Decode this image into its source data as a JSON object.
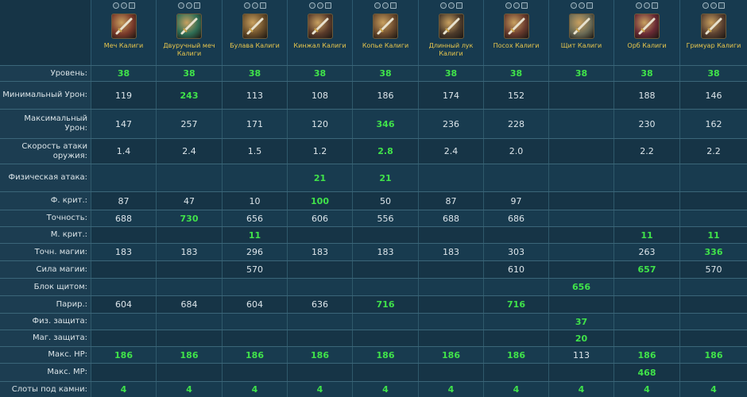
{
  "items": [
    {
      "name": "Меч Калиги",
      "icon": "sword-icon",
      "color": "#7a3a2a"
    },
    {
      "name": "Двуручный меч Калиги",
      "icon": "greatsword-icon",
      "color": "#2f6e55"
    },
    {
      "name": "Булава Калиги",
      "icon": "mace-icon",
      "color": "#6a4e2a"
    },
    {
      "name": "Кинжал Калиги",
      "icon": "dagger-icon",
      "color": "#5a3b2a"
    },
    {
      "name": "Копье Калиги",
      "icon": "spear-icon",
      "color": "#6b4a2d"
    },
    {
      "name": "Длинный лук Калиги",
      "icon": "longbow-icon",
      "color": "#4c3a2a"
    },
    {
      "name": "Посох Калиги",
      "icon": "staff-icon",
      "color": "#6a3b2d"
    },
    {
      "name": "Щит Калиги",
      "icon": "shield-icon",
      "color": "#6a6a55"
    },
    {
      "name": "Орб Калиги",
      "icon": "orb-icon",
      "color": "#6a2a35"
    },
    {
      "name": "Гримуар Калиги",
      "icon": "grimoire-icon",
      "color": "#5a4030"
    }
  ],
  "rows": [
    {
      "label": "Уровень:",
      "cells": [
        {
          "v": "38",
          "hi": true
        },
        {
          "v": "38",
          "hi": true
        },
        {
          "v": "38",
          "hi": true
        },
        {
          "v": "38",
          "hi": true
        },
        {
          "v": "38",
          "hi": true
        },
        {
          "v": "38",
          "hi": true
        },
        {
          "v": "38",
          "hi": true
        },
        {
          "v": "38",
          "hi": true
        },
        {
          "v": "38",
          "hi": true
        },
        {
          "v": "38",
          "hi": true
        }
      ]
    },
    {
      "label": "Минимальный Урон:",
      "cells": [
        {
          "v": "119"
        },
        {
          "v": "243",
          "hi": true
        },
        {
          "v": "113"
        },
        {
          "v": "108"
        },
        {
          "v": "186"
        },
        {
          "v": "174"
        },
        {
          "v": "152"
        },
        {
          "v": ""
        },
        {
          "v": "188"
        },
        {
          "v": "146"
        }
      ]
    },
    {
      "label": "Максимальный Урон:",
      "cells": [
        {
          "v": "147"
        },
        {
          "v": "257"
        },
        {
          "v": "171"
        },
        {
          "v": "120"
        },
        {
          "v": "346",
          "hi": true
        },
        {
          "v": "236"
        },
        {
          "v": "228"
        },
        {
          "v": ""
        },
        {
          "v": "230"
        },
        {
          "v": "162"
        }
      ]
    },
    {
      "label": "Скорость атаки оружия:",
      "cells": [
        {
          "v": "1.4"
        },
        {
          "v": "2.4"
        },
        {
          "v": "1.5"
        },
        {
          "v": "1.2"
        },
        {
          "v": "2.8",
          "hi": true
        },
        {
          "v": "2.4"
        },
        {
          "v": "2.0"
        },
        {
          "v": ""
        },
        {
          "v": "2.2"
        },
        {
          "v": "2.2"
        }
      ]
    },
    {
      "label": "Физическая атака:",
      "cells": [
        {
          "v": ""
        },
        {
          "v": ""
        },
        {
          "v": ""
        },
        {
          "v": "21",
          "hi": true
        },
        {
          "v": "21",
          "hi": true
        },
        {
          "v": ""
        },
        {
          "v": ""
        },
        {
          "v": ""
        },
        {
          "v": ""
        },
        {
          "v": ""
        }
      ]
    },
    {
      "label": "Ф. крит.:",
      "cells": [
        {
          "v": "87"
        },
        {
          "v": "47"
        },
        {
          "v": "10"
        },
        {
          "v": "100",
          "hi": true
        },
        {
          "v": "50"
        },
        {
          "v": "87"
        },
        {
          "v": "97"
        },
        {
          "v": ""
        },
        {
          "v": ""
        },
        {
          "v": ""
        }
      ]
    },
    {
      "label": "Точность:",
      "cells": [
        {
          "v": "688"
        },
        {
          "v": "730",
          "hi": true
        },
        {
          "v": "656"
        },
        {
          "v": "606"
        },
        {
          "v": "556"
        },
        {
          "v": "688"
        },
        {
          "v": "686"
        },
        {
          "v": ""
        },
        {
          "v": ""
        },
        {
          "v": ""
        }
      ]
    },
    {
      "label": "М. крит.:",
      "cells": [
        {
          "v": ""
        },
        {
          "v": ""
        },
        {
          "v": "11",
          "hi": true
        },
        {
          "v": ""
        },
        {
          "v": ""
        },
        {
          "v": ""
        },
        {
          "v": ""
        },
        {
          "v": ""
        },
        {
          "v": "11",
          "hi": true
        },
        {
          "v": "11",
          "hi": true
        }
      ]
    },
    {
      "label": "Точн. магии:",
      "cells": [
        {
          "v": "183"
        },
        {
          "v": "183"
        },
        {
          "v": "296"
        },
        {
          "v": "183"
        },
        {
          "v": "183"
        },
        {
          "v": "183"
        },
        {
          "v": "303"
        },
        {
          "v": ""
        },
        {
          "v": "263"
        },
        {
          "v": "336",
          "hi": true
        }
      ]
    },
    {
      "label": "Сила магии:",
      "cells": [
        {
          "v": ""
        },
        {
          "v": ""
        },
        {
          "v": "570"
        },
        {
          "v": ""
        },
        {
          "v": ""
        },
        {
          "v": ""
        },
        {
          "v": "610"
        },
        {
          "v": ""
        },
        {
          "v": "657",
          "hi": true
        },
        {
          "v": "570"
        }
      ]
    },
    {
      "label": "Блок щитом:",
      "cells": [
        {
          "v": ""
        },
        {
          "v": ""
        },
        {
          "v": ""
        },
        {
          "v": ""
        },
        {
          "v": ""
        },
        {
          "v": ""
        },
        {
          "v": ""
        },
        {
          "v": "656",
          "hi": true
        },
        {
          "v": ""
        },
        {
          "v": ""
        }
      ]
    },
    {
      "label": "Парир.:",
      "cells": [
        {
          "v": "604"
        },
        {
          "v": "684"
        },
        {
          "v": "604"
        },
        {
          "v": "636"
        },
        {
          "v": "716",
          "hi": true
        },
        {
          "v": ""
        },
        {
          "v": "716",
          "hi": true
        },
        {
          "v": ""
        },
        {
          "v": ""
        },
        {
          "v": ""
        }
      ]
    },
    {
      "label": "Физ. защита:",
      "cells": [
        {
          "v": ""
        },
        {
          "v": ""
        },
        {
          "v": ""
        },
        {
          "v": ""
        },
        {
          "v": ""
        },
        {
          "v": ""
        },
        {
          "v": ""
        },
        {
          "v": "37",
          "hi": true
        },
        {
          "v": ""
        },
        {
          "v": ""
        }
      ]
    },
    {
      "label": "Маг. защита:",
      "cells": [
        {
          "v": ""
        },
        {
          "v": ""
        },
        {
          "v": ""
        },
        {
          "v": ""
        },
        {
          "v": ""
        },
        {
          "v": ""
        },
        {
          "v": ""
        },
        {
          "v": "20",
          "hi": true
        },
        {
          "v": ""
        },
        {
          "v": ""
        }
      ]
    },
    {
      "label": "Макс. HP:",
      "cells": [
        {
          "v": "186",
          "hi": true
        },
        {
          "v": "186",
          "hi": true
        },
        {
          "v": "186",
          "hi": true
        },
        {
          "v": "186",
          "hi": true
        },
        {
          "v": "186",
          "hi": true
        },
        {
          "v": "186",
          "hi": true
        },
        {
          "v": "186",
          "hi": true
        },
        {
          "v": "113"
        },
        {
          "v": "186",
          "hi": true
        },
        {
          "v": "186",
          "hi": true
        }
      ]
    },
    {
      "label": "Макс. MP:",
      "cells": [
        {
          "v": ""
        },
        {
          "v": ""
        },
        {
          "v": ""
        },
        {
          "v": ""
        },
        {
          "v": ""
        },
        {
          "v": ""
        },
        {
          "v": ""
        },
        {
          "v": ""
        },
        {
          "v": "468",
          "hi": true
        },
        {
          "v": ""
        }
      ]
    },
    {
      "label": "Слоты под камни:",
      "cells": [
        {
          "v": "4",
          "hi": true
        },
        {
          "v": "4",
          "hi": true
        },
        {
          "v": "4",
          "hi": true
        },
        {
          "v": "4",
          "hi": true
        },
        {
          "v": "4",
          "hi": true
        },
        {
          "v": "4",
          "hi": true
        },
        {
          "v": "4",
          "hi": true
        },
        {
          "v": "4",
          "hi": true
        },
        {
          "v": "4",
          "hi": true
        },
        {
          "v": "4",
          "hi": true
        }
      ]
    }
  ],
  "colors": {
    "highlight": "#40e34a",
    "item_name": "#e9c74d",
    "background": "#163446"
  }
}
